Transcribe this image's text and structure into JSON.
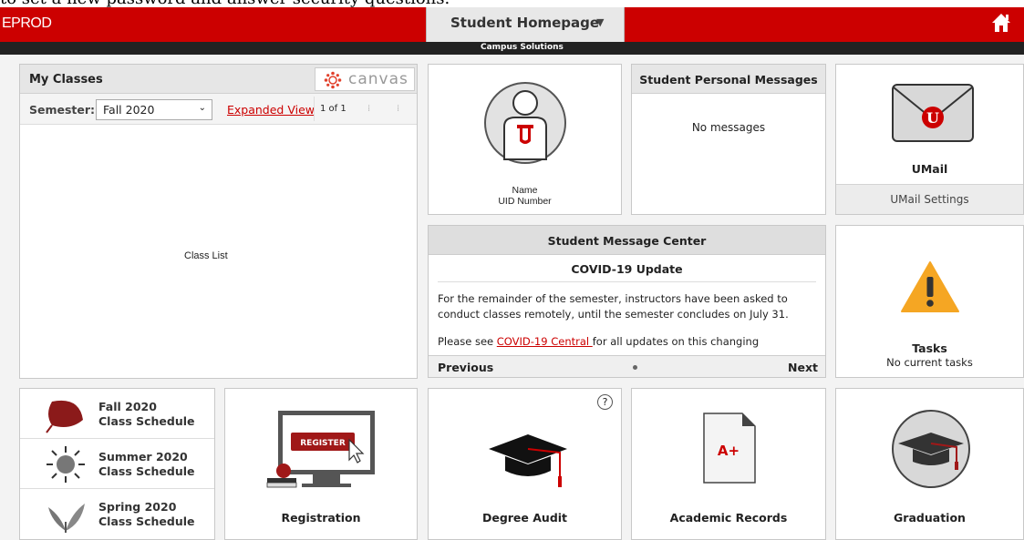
{
  "header": {
    "top_caption": "to set a new password and answer security questions.",
    "environment": "EPROD",
    "homepage_label": "Student Homepage",
    "subtitle": "Campus Solutions"
  },
  "my_classes": {
    "title": "My Classes",
    "canvas_label": "canvas",
    "semester_label": "Semester:",
    "semester_value": "Fall 2020",
    "expanded_view": "Expanded View",
    "page_info": "1 of 1",
    "class_list": "Class List"
  },
  "profile": {
    "name": "Name",
    "uid": "UID Number"
  },
  "messages": {
    "title": "Student Personal Messages",
    "empty": "No messages"
  },
  "umail": {
    "title": "UMail",
    "settings": "UMail Settings"
  },
  "message_center": {
    "title": "Student Message Center",
    "subtitle": "COVID-19 Update",
    "body": "For the remainder of the semester, instructors have been asked to conduct classes remotely, until the semester concludes on July 31.",
    "body2_prefix": "Please see ",
    "body2_link": "COVID-19 Central ",
    "body2_suffix": "for all updates on this changing",
    "previous": "Previous",
    "next": "Next"
  },
  "tasks": {
    "title": "Tasks",
    "status": "No current tasks"
  },
  "schedules": [
    {
      "line1": "Fall 2020",
      "line2": "Class Schedule"
    },
    {
      "line1": "Summer 2020",
      "line2": "Class Schedule"
    },
    {
      "line1": "Spring 2020",
      "line2": "Class Schedule"
    }
  ],
  "registration": {
    "title": "Registration",
    "button_text": "REGISTER"
  },
  "degree_audit": {
    "title": "Degree Audit",
    "help": "?"
  },
  "academic_records": {
    "title": "Academic Records",
    "grade": "A+"
  },
  "graduation": {
    "title": "Graduation"
  },
  "colors": {
    "brand_red": "#cc0000",
    "dark_bar": "#222222",
    "warning_orange": "#f5a623"
  }
}
